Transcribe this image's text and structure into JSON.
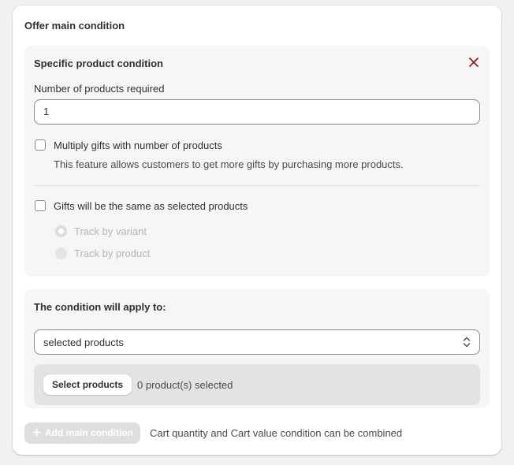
{
  "card": {
    "title": "Offer main condition"
  },
  "product_condition": {
    "title": "Specific product condition",
    "close_icon": "close-icon",
    "quantity_label": "Number of products required",
    "quantity_value": "1",
    "multiply_checkbox": {
      "label": "Multiply gifts with number of products",
      "checked": false,
      "help_text": "This feature allows customers to get more gifts by purchasing more products."
    },
    "same_gifts_checkbox": {
      "label": "Gifts will be the same as selected products",
      "checked": false
    },
    "tracking_options": [
      {
        "label": "Track by variant",
        "selected": true,
        "disabled": true
      },
      {
        "label": "Track by product",
        "selected": false,
        "disabled": true
      }
    ]
  },
  "apply_section": {
    "title": "The condition will apply to:",
    "select_value": "selected products",
    "select_icon": "select-chevrons-icon",
    "select_products_button": "Select products",
    "selected_count_text": "0 product(s) selected"
  },
  "footer": {
    "add_button_label": "Add main condition",
    "add_button_disabled": true,
    "add_icon": "plus-icon",
    "note": "Cart quantity and Cart value condition can be combined"
  },
  "colors": {
    "background": "#f1f1f1",
    "card": "#ffffff",
    "section": "#f6f6f6",
    "close_icon": "#8e1f2b",
    "disabled_button": "#dedede",
    "products_box": "#e3e3e3"
  }
}
